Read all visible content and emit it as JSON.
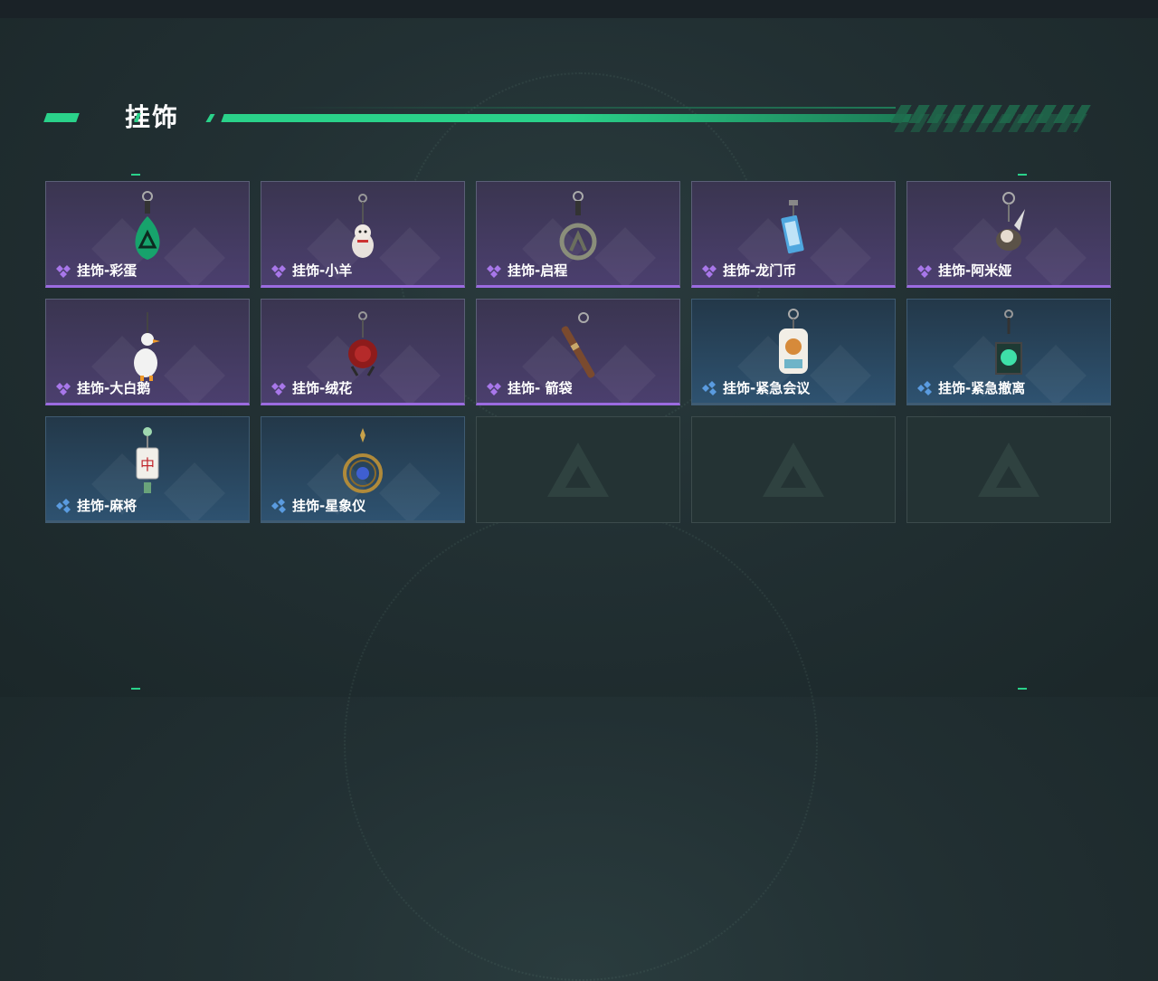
{
  "section": {
    "title": "挂饰"
  },
  "colors": {
    "accent": "#2ad28a",
    "epic": "#9b6be0",
    "rare": "#4d8fd4"
  },
  "items": [
    {
      "label": "挂饰-彩蛋",
      "rarity": "epic",
      "icon": "green-egg-charm-icon"
    },
    {
      "label": "挂饰-小羊",
      "rarity": "epic",
      "icon": "lamb-charm-icon"
    },
    {
      "label": "挂饰-启程",
      "rarity": "epic",
      "icon": "ring-emblem-charm-icon"
    },
    {
      "label": "挂饰-龙门币",
      "rarity": "epic",
      "icon": "coin-card-charm-icon"
    },
    {
      "label": "挂饰-阿米娅",
      "rarity": "epic",
      "icon": "amiya-charm-icon"
    },
    {
      "label": "挂饰-大白鹅",
      "rarity": "epic",
      "icon": "goose-charm-icon"
    },
    {
      "label": "挂饰-绒花",
      "rarity": "epic",
      "icon": "rose-charm-icon"
    },
    {
      "label": "挂饰- 箭袋",
      "rarity": "epic",
      "icon": "quiver-charm-icon"
    },
    {
      "label": "挂饰-紧急会议",
      "rarity": "rare",
      "icon": "meeting-charm-icon"
    },
    {
      "label": "挂饰-紧急撤离",
      "rarity": "rare",
      "icon": "evac-charm-icon"
    },
    {
      "label": "挂饰-麻将",
      "rarity": "rare",
      "icon": "mahjong-charm-icon"
    },
    {
      "label": "挂饰-星象仪",
      "rarity": "rare",
      "icon": "astrolabe-charm-icon"
    }
  ],
  "empty_slots": 3
}
